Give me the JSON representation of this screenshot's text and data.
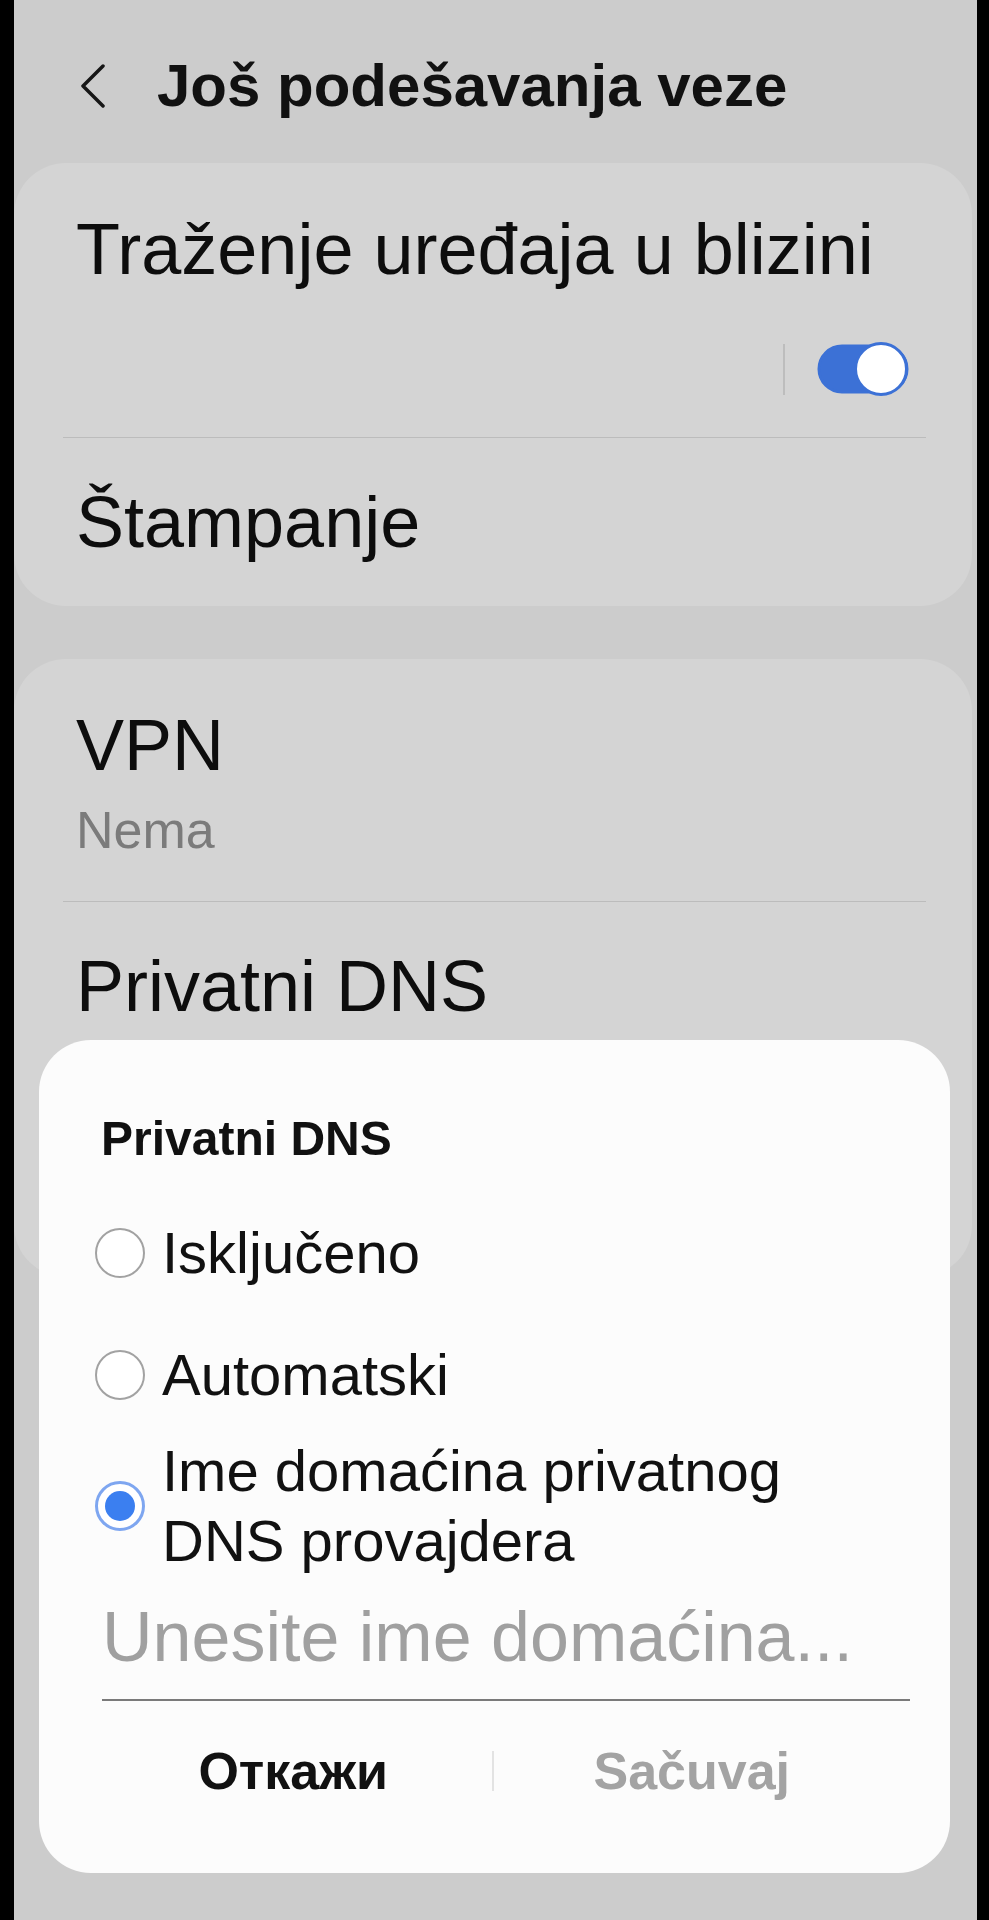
{
  "header": {
    "title": "Još podešavanja veze"
  },
  "groups": [
    {
      "items": [
        {
          "kind": "toggle",
          "title": "Traženje uređaja u blizini",
          "on": true
        },
        {
          "kind": "plain",
          "title": "Štampanje"
        }
      ]
    },
    {
      "items": [
        {
          "kind": "plain",
          "title": "VPN",
          "subtitle": "Nema"
        },
        {
          "kind": "plain",
          "title": "Privatni DNS"
        }
      ]
    }
  ],
  "dialog": {
    "title": "Privatni DNS",
    "options": [
      {
        "label": "Isključeno",
        "selected": false
      },
      {
        "label": "Automatski",
        "selected": false
      },
      {
        "label": "Ime domaćina privatnog DNS provajdera",
        "selected": true
      }
    ],
    "hostname_field": {
      "placeholder": "Unesite ime domaćina..."
    },
    "buttons": [
      {
        "label": "Откажи",
        "disabled": false
      },
      {
        "label": "Sačuvaj",
        "disabled": true
      }
    ]
  }
}
